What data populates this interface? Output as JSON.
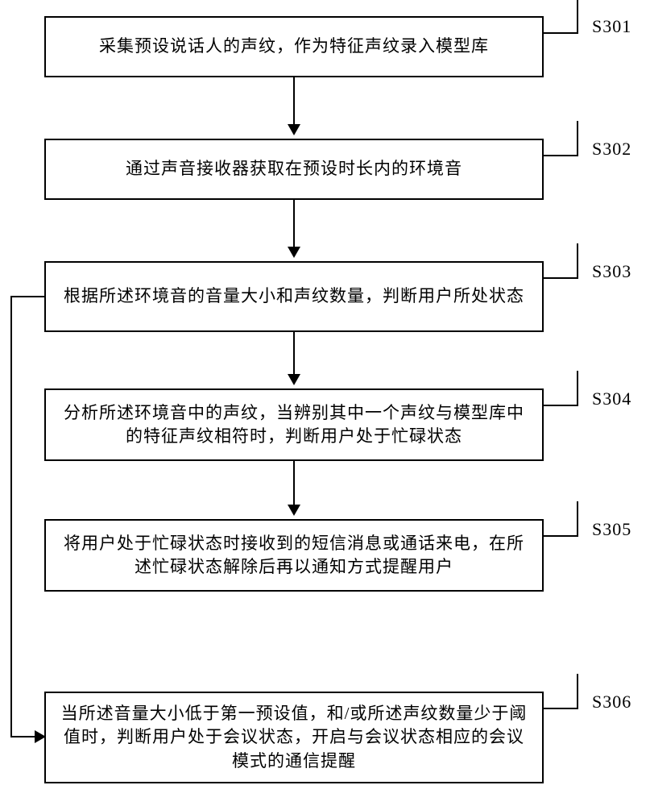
{
  "steps": {
    "s301": {
      "label": "S301",
      "text": "采集预设说话人的声纹，作为特征声纹录入模型库"
    },
    "s302": {
      "label": "S302",
      "text": "通过声音接收器获取在预设时长内的环境音"
    },
    "s303": {
      "label": "S303",
      "text": "根据所述环境音的音量大小和声纹数量，判断用户所处状态"
    },
    "s304": {
      "label": "S304",
      "text": "分析所述环境音中的声纹，当辨别其中一个声纹与模型库中的特征声纹相符时，判断用户处于忙碌状态"
    },
    "s305": {
      "label": "S305",
      "text": "将用户处于忙碌状态时接收到的短信消息或通话来电，在所述忙碌状态解除后再以通知方式提醒用户"
    },
    "s306": {
      "label": "S306",
      "text": "当所述音量大小低于第一预设值，和/或所述声纹数量少于阈值时，判断用户处于会议状态，开启与会议状态相应的会议模式的通信提醒"
    }
  }
}
